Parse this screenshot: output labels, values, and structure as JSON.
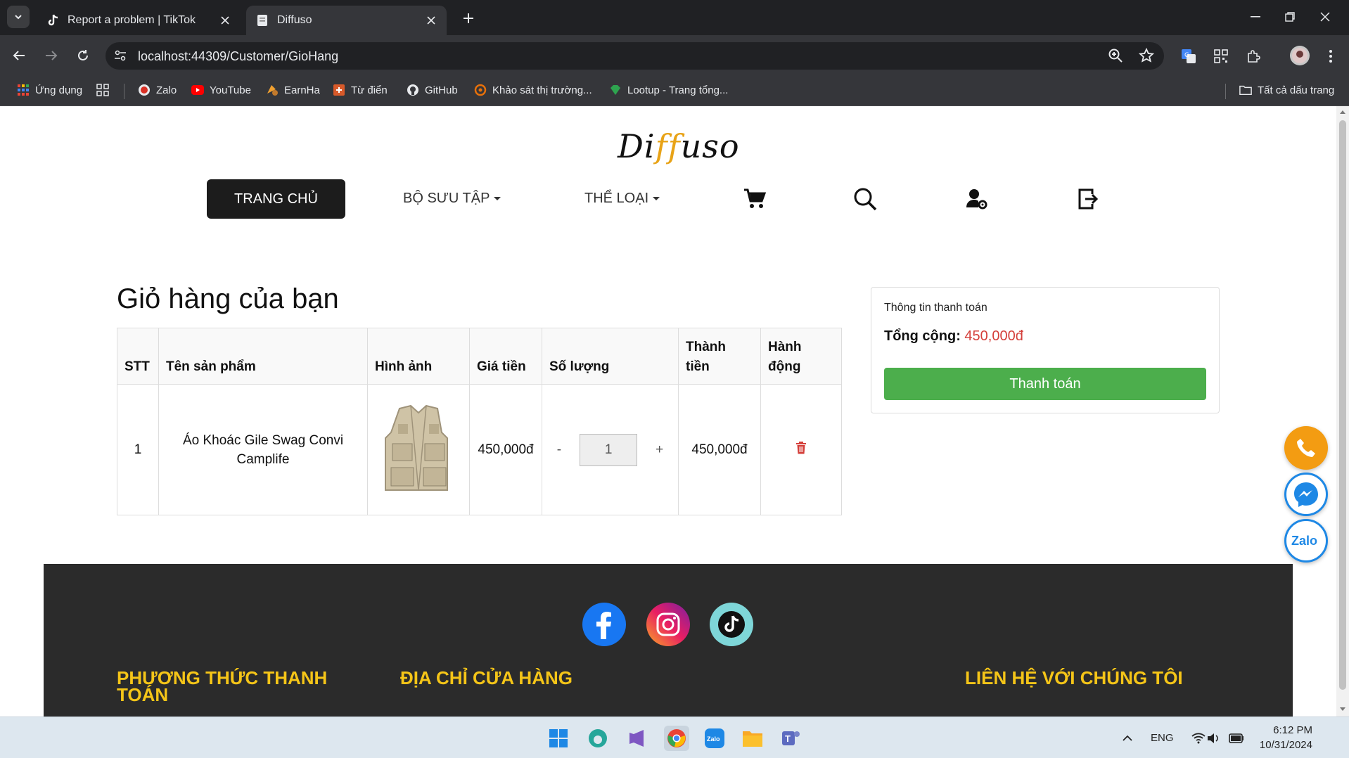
{
  "browser": {
    "tabs": [
      {
        "title": "Report a problem | TikTok",
        "icon": "tiktok-icon"
      },
      {
        "title": "Diffuso",
        "icon": "page-icon"
      }
    ],
    "url": "localhost:44309/Customer/GioHang",
    "bookmarks": [
      {
        "label": "Ứng dụng",
        "icon": "apps-icon"
      },
      {
        "label": "",
        "icon": "grid-icon"
      },
      {
        "label": "Zalo",
        "icon": "zalo-icon"
      },
      {
        "label": "YouTube",
        "icon": "youtube-icon"
      },
      {
        "label": "EarnHa",
        "icon": "earnha-icon"
      },
      {
        "label": "Từ điển",
        "icon": "dictionary-icon"
      },
      {
        "label": "GitHub",
        "icon": "github-icon"
      },
      {
        "label": "Khảo sát thị trường...",
        "icon": "survey-icon"
      },
      {
        "label": "Lootup - Trang tổng...",
        "icon": "lootup-icon"
      }
    ],
    "all_bookmarks": "Tất cả dấu trang"
  },
  "site": {
    "logo_pre": "Di",
    "logo_ff": "ff",
    "logo_post": "uso",
    "nav": {
      "home": "TRANG CHỦ",
      "collection": "BỘ SƯU TẬP",
      "category": "THỂ LOẠI"
    }
  },
  "cart": {
    "title": "Giỏ hàng của bạn",
    "headers": [
      "STT",
      "Tên sản phẩm",
      "Hình ảnh",
      "Giá tiền",
      "Số lượng",
      "Thành tiền",
      "Hành động"
    ],
    "rows": [
      {
        "stt": "1",
        "name": "Áo Khoác Gile Swag Convi Camplife",
        "price": "450,000đ",
        "qty": "1",
        "total": "450,000đ",
        "minus": "-",
        "plus": "+"
      }
    ]
  },
  "summary": {
    "title": "Thông tin thanh toán",
    "total_label": "Tổng cộng:",
    "total_value": "450,000đ",
    "pay_button": "Thanh toán"
  },
  "footer": {
    "payment_heading": "PHƯƠNG THỨC THANH TOÁN",
    "address_heading": "ĐỊA CHỈ CỬA HÀNG",
    "contact_heading": "LIÊN HỆ VỚI CHÚNG TÔI"
  },
  "taskbar": {
    "lang": "ENG",
    "time": "6:12 PM",
    "date": "10/31/2024"
  },
  "colors": {
    "accent_green": "#4cae4c",
    "price_red": "#d43f3a",
    "footer_heading": "#f5c518",
    "footer_bg": "#2b2b2b"
  }
}
